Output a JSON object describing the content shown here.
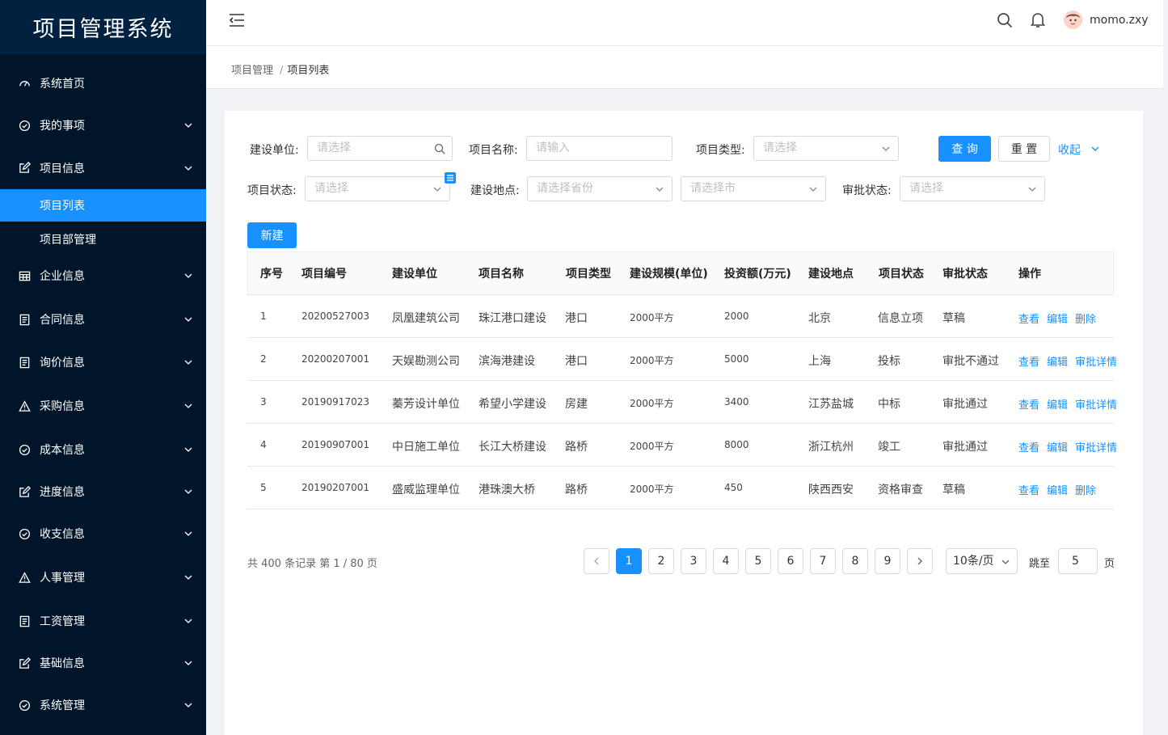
{
  "app_title": "项目管理系统",
  "sidebar": {
    "items": [
      {
        "label": "系统首页",
        "icon": "dashboard-icon"
      },
      {
        "label": "我的事项",
        "icon": "check-circle-icon"
      },
      {
        "label": "项目信息",
        "icon": "edit-icon"
      },
      {
        "label": "项目列表"
      },
      {
        "label": "项目部管理"
      },
      {
        "label": "企业信息",
        "icon": "table-icon"
      },
      {
        "label": "合同信息",
        "icon": "file-text-icon"
      },
      {
        "label": "询价信息",
        "icon": "file-text-icon"
      },
      {
        "label": "采购信息",
        "icon": "warning-icon"
      },
      {
        "label": "成本信息",
        "icon": "check-circle-icon"
      },
      {
        "label": "进度信息",
        "icon": "edit-icon"
      },
      {
        "label": "收支信息",
        "icon": "check-circle-icon"
      },
      {
        "label": "人事管理",
        "icon": "warning-icon"
      },
      {
        "label": "工资管理",
        "icon": "file-text-icon"
      },
      {
        "label": "基础信息",
        "icon": "edit-icon"
      },
      {
        "label": "系统管理",
        "icon": "check-circle-icon"
      }
    ],
    "accent": "#1890ff",
    "bg": "#001529"
  },
  "header": {
    "username": "momo.zxy"
  },
  "breadcrumb": {
    "parent": "项目管理",
    "sep": "/",
    "current": "项目列表"
  },
  "filters": {
    "build_unit": {
      "label": "建设单位:",
      "placeholder": "请选择"
    },
    "project_name": {
      "label": "项目名称:",
      "placeholder": "请输入"
    },
    "project_type": {
      "label": "项目类型:",
      "placeholder": "请选择"
    },
    "project_status": {
      "label": "项目状态:",
      "placeholder": "请选择"
    },
    "location": {
      "label": "建设地点:",
      "province_placeholder": "请选择省份",
      "city_placeholder": "请选择市"
    },
    "approval_status": {
      "label": "审批状态:",
      "placeholder": "请选择"
    },
    "query_button": "查 询",
    "reset_button": "重 置",
    "collapse_link": "收起"
  },
  "new_button": "新建",
  "table": {
    "columns": [
      "序号",
      "项目编号",
      "建设单位",
      "项目名称",
      "项目类型",
      "建设规模(单位)",
      "投资额(万元)",
      "建设地点",
      "项目状态",
      "审批状态",
      "操作"
    ],
    "rows": [
      {
        "no": "1",
        "code": "20200527003",
        "unit": "凤凰建筑公司",
        "name": "珠江港口建设",
        "type": "港口",
        "scale": "2000平方",
        "invest": "2000",
        "place": "北京",
        "status": "信息立项",
        "approval": "草稿",
        "actions": [
          "查看",
          "编辑",
          "删除"
        ]
      },
      {
        "no": "2",
        "code": "20200207001",
        "unit": "天娱勘测公司",
        "name": "滨海港建设",
        "type": "港口",
        "scale": "2000平方",
        "invest": "5000",
        "place": "上海",
        "status": "投标",
        "approval": "审批不通过",
        "actions": [
          "查看",
          "编辑",
          "审批详情"
        ]
      },
      {
        "no": "3",
        "code": "20190917023",
        "unit": "蓁芳设计单位",
        "name": "希望小学建设",
        "type": "房建",
        "scale": "2000平方",
        "invest": "3400",
        "place": "江苏盐城",
        "status": "中标",
        "approval": "审批通过",
        "actions": [
          "查看",
          "编辑",
          "审批详情"
        ]
      },
      {
        "no": "4",
        "code": "20190907001",
        "unit": "中日施工单位",
        "name": "长江大桥建设",
        "type": "路桥",
        "scale": "2000平方",
        "invest": "8000",
        "place": "浙江杭州",
        "status": "竣工",
        "approval": "审批通过",
        "actions": [
          "查看",
          "编辑",
          "审批详情"
        ]
      },
      {
        "no": "5",
        "code": "20190207001",
        "unit": "盛威监理单位",
        "name": "港珠澳大桥",
        "type": "路桥",
        "scale": "2000平方",
        "invest": "450",
        "place": "陕西西安",
        "status": "资格审查",
        "approval": "草稿",
        "actions": [
          "查看",
          "编辑",
          "删除"
        ]
      }
    ]
  },
  "pagination": {
    "total_text": "共 400 条记录 第 1 / 80 页",
    "pages": [
      "1",
      "2",
      "3",
      "4",
      "5",
      "6",
      "7",
      "8",
      "9"
    ],
    "current": "1",
    "page_size": "10条/页",
    "jump_label": "跳至",
    "jump_value": "5",
    "page_suffix": "页"
  }
}
